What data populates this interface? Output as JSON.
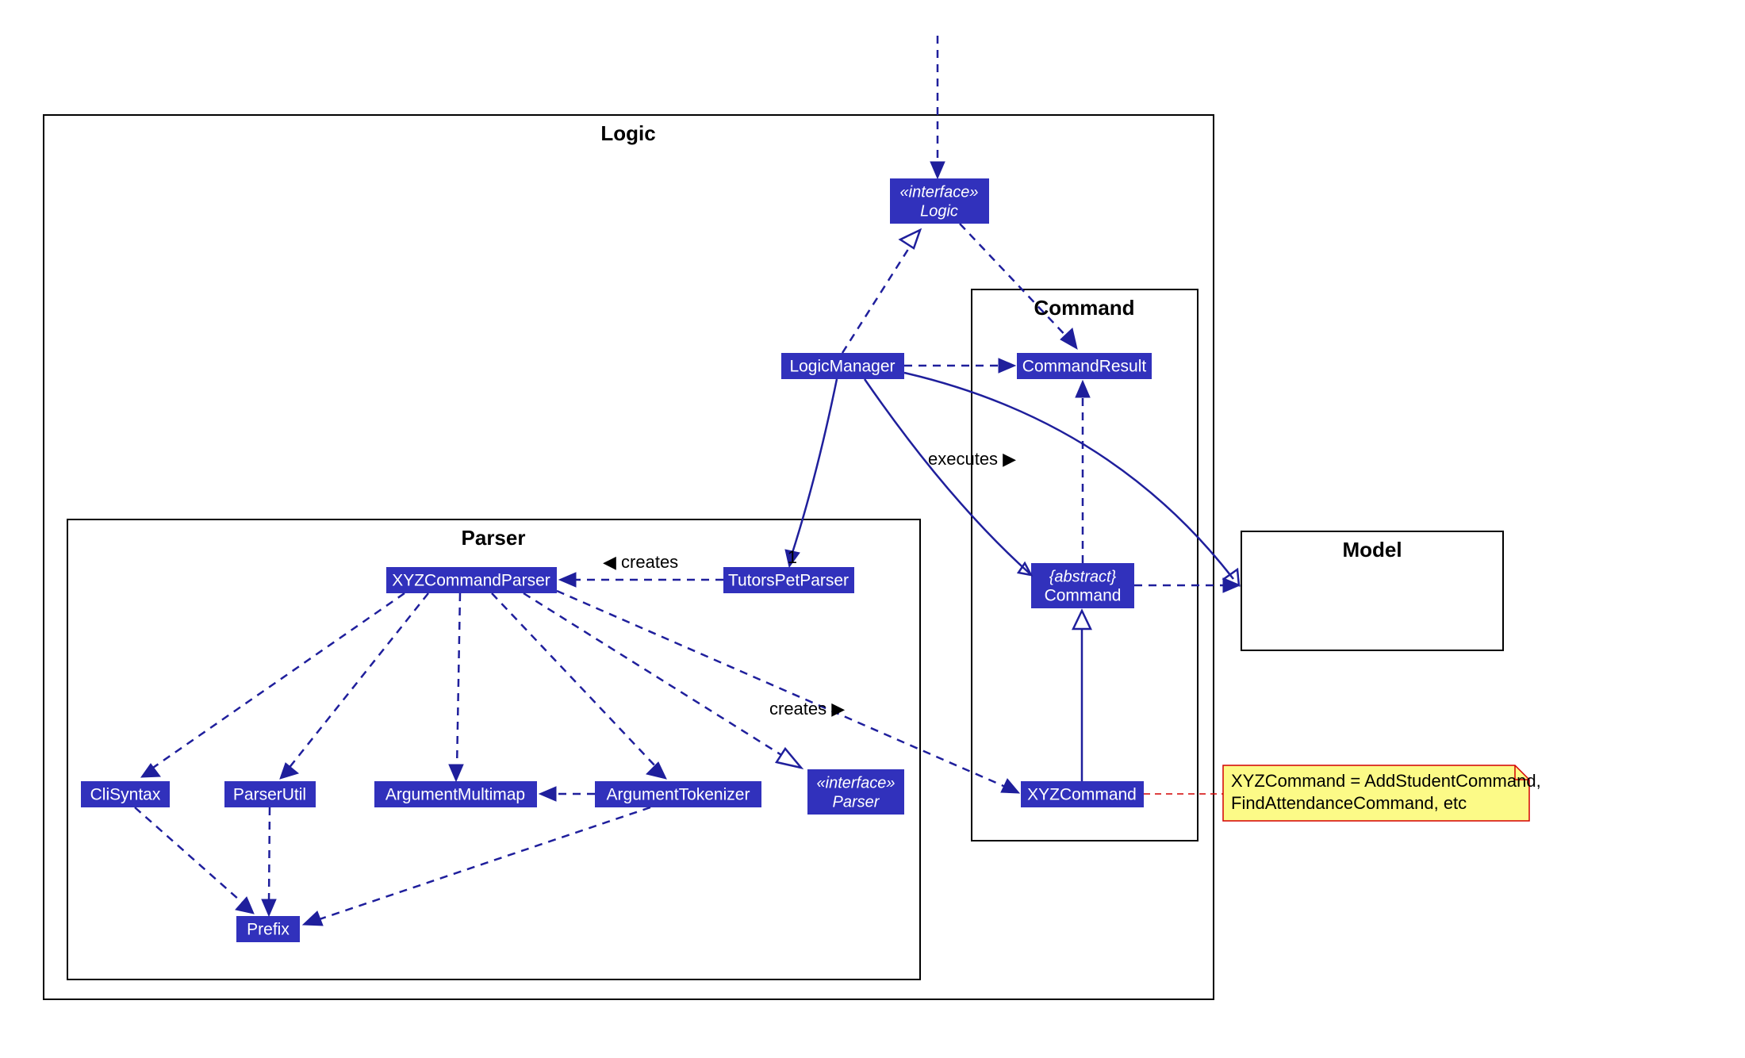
{
  "packages": {
    "logic": {
      "title": "Logic"
    },
    "parser": {
      "title": "Parser"
    },
    "command": {
      "title": "Command"
    },
    "model": {
      "title": "Model"
    }
  },
  "classes": {
    "logic_iface": {
      "stereotype": "«interface»",
      "name": "Logic"
    },
    "logic_manager": {
      "name": "LogicManager"
    },
    "command_result": {
      "name": "CommandResult"
    },
    "abstract_command": {
      "stereotype": "{abstract}",
      "name": "Command"
    },
    "xyz_command": {
      "name": "XYZCommand"
    },
    "tutorspet_parser": {
      "name": "TutorsPetParser"
    },
    "xyz_command_parser": {
      "name": "XYZCommandParser"
    },
    "parser_iface": {
      "stereotype": "«interface»",
      "name": "Parser"
    },
    "cli_syntax": {
      "name": "CliSyntax"
    },
    "parser_util": {
      "name": "ParserUtil"
    },
    "argument_multimap": {
      "name": "ArgumentMultimap"
    },
    "argument_tokenizer": {
      "name": "ArgumentTokenizer"
    },
    "prefix": {
      "name": "Prefix"
    }
  },
  "labels": {
    "creates1": "◀ creates",
    "creates2": "creates ▶",
    "executes": "executes ▶",
    "mult1": "1"
  },
  "note": {
    "line1": "XYZCommand = AddStudentCommand,",
    "line2": "FindAttendanceCommand, etc"
  }
}
